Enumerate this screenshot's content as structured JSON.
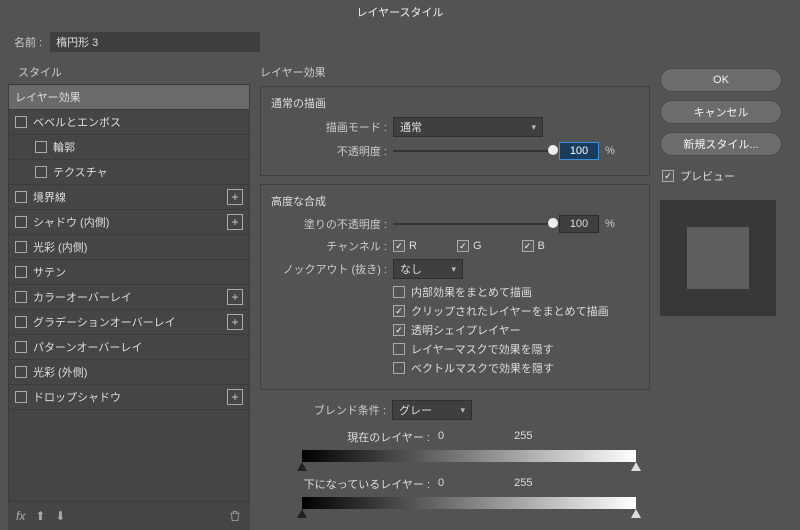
{
  "title": "レイヤースタイル",
  "nameLabel": "名前 :",
  "nameValue": "楕円形 3",
  "stylesHeader": "スタイル",
  "styles": {
    "layerEffects": "レイヤー効果",
    "bevel": "ベベルとエンボス",
    "contour": "輪郭",
    "texture": "テクスチャ",
    "stroke": "境界線",
    "innerShadow": "シャドウ (内側)",
    "innerGlow": "光彩 (内側)",
    "satin": "サテン",
    "colorOverlay": "カラーオーバーレイ",
    "gradOverlay": "グラデーションオーバーレイ",
    "patternOverlay": "パターンオーバーレイ",
    "outerGlow": "光彩 (外側)",
    "dropShadow": "ドロップシャドウ"
  },
  "mid": {
    "sectionTitle": "レイヤー効果",
    "normalFrame": "通常の描画",
    "blendModeLabel": "描画モード :",
    "blendModeValue": "通常",
    "opacityLabel": "不透明度 :",
    "opacityValue": "100",
    "pct": "%",
    "advFrame": "高度な合成",
    "fillOpacityLabel": "塗りの不透明度 :",
    "fillOpacityValue": "100",
    "channelLabel": "チャンネル :",
    "R": "R",
    "G": "G",
    "B": "B",
    "knockoutLabel": "ノックアウト (抜き) :",
    "knockoutValue": "なし",
    "opts": {
      "a": "内部効果をまとめて描画",
      "b": "クリップされたレイヤーをまとめて描画",
      "c": "透明シェイプレイヤー",
      "d": "レイヤーマスクで効果を隠す",
      "e": "ベクトルマスクで効果を隠す"
    },
    "blendIfLabel": "ブレンド条件 :",
    "blendIfValue": "グレー",
    "thisLayer": "現在のレイヤー :",
    "underLayer": "下になっているレイヤー :",
    "v0": "0",
    "v255": "255"
  },
  "buttons": {
    "ok": "OK",
    "cancel": "キャンセル",
    "newStyle": "新規スタイル...",
    "preview": "プレビュー"
  },
  "footer": {
    "fx": "fx"
  }
}
